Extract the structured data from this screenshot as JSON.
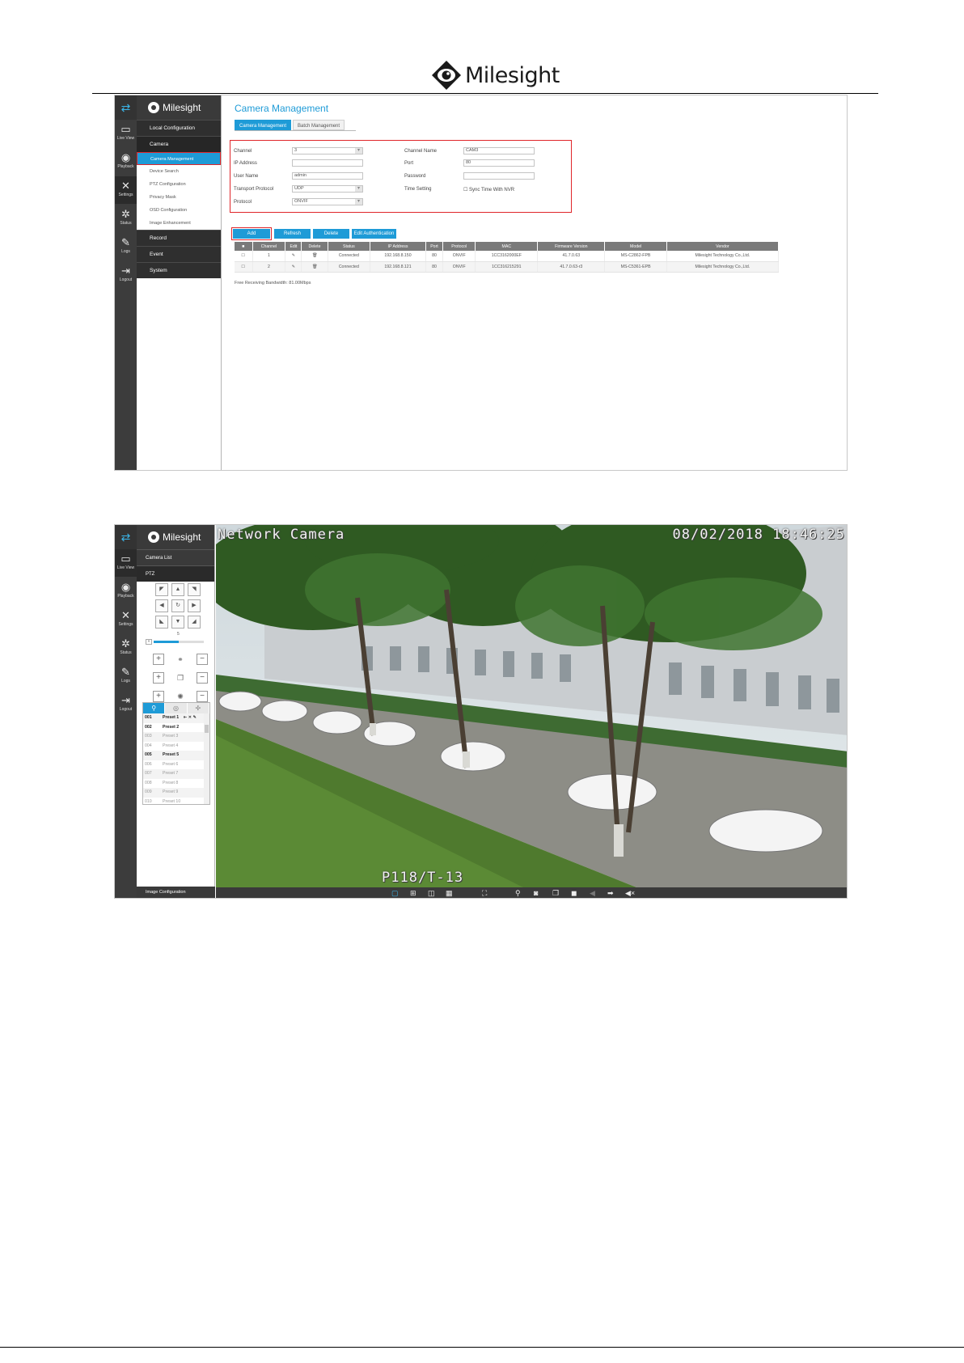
{
  "brand": {
    "name": "Milesight"
  },
  "iconbar": {
    "live_view": "Live View",
    "playback": "Playback",
    "settings": "Settings",
    "status": "Status",
    "logs": "Logs",
    "logout": "Logout"
  },
  "screen1": {
    "menu": {
      "local_config": "Local Configuration",
      "camera": "Camera",
      "sub_items": [
        "Camera Management",
        "Device Search",
        "PTZ Configuration",
        "Privacy Mask",
        "OSD Configuration",
        "Image Enhancement"
      ],
      "record": "Record",
      "event": "Event",
      "system": "System"
    },
    "title": "Camera Management",
    "tabs": [
      "Camera Management",
      "Batch Management"
    ],
    "form": {
      "channel_label": "Channel",
      "channel_value": "3",
      "ip_label": "IP Address",
      "ip_value": "",
      "user_label": "User Name",
      "user_value": "admin",
      "transport_label": "Transport Protocol",
      "transport_value": "UDP",
      "protocol_label": "Protocol",
      "protocol_value": "ONVIF",
      "chname_label": "Channel Name",
      "chname_value": "CAM3",
      "port_label": "Port",
      "port_value": "80",
      "password_label": "Password",
      "password_value": "",
      "timeset_label": "Time Setting",
      "timeset_value": "Sync Time With NVR"
    },
    "buttons": {
      "add": "Add",
      "refresh": "Refresh",
      "delete": "Delete",
      "edit_auth": "Edit Authentication"
    },
    "table": {
      "headers": [
        "Channel",
        "Edit",
        "Delete",
        "Status",
        "IP Address",
        "Port",
        "Protocol",
        "MAC",
        "Firmware Version",
        "Model",
        "Vendor"
      ],
      "rows": [
        [
          "1",
          "Connected",
          "192.168.8.150",
          "80",
          "ONVIF",
          "1CC3162000EF",
          "41.7.0.63",
          "MS-C2862-FPB",
          "Milesight Technology Co.,Ltd."
        ],
        [
          "2",
          "Connected",
          "192.168.8.121",
          "80",
          "ONVIF",
          "1CC316215291",
          "41.7.0.63-r3",
          "MS-C5361-EPB",
          "Milesight Technology Co.,Ltd."
        ]
      ]
    },
    "bandwidth": "Free Receiving Bandwidth:  81.00Mbps"
  },
  "screen2": {
    "menu": {
      "camera_list": "Camera List",
      "ptz": "PTZ",
      "image_config": "Image Configuration"
    },
    "speed_value": "5",
    "presets": [
      {
        "num": "001",
        "name": "Preset 1",
        "bold": true
      },
      {
        "num": "002",
        "name": "Preset 2",
        "bold": true
      },
      {
        "num": "003",
        "name": "Preset 3",
        "bold": false
      },
      {
        "num": "004",
        "name": "Preset 4",
        "bold": false
      },
      {
        "num": "005",
        "name": "Preset 5",
        "bold": true
      },
      {
        "num": "006",
        "name": "Preset 6",
        "bold": false
      },
      {
        "num": "007",
        "name": "Preset 7",
        "bold": false
      },
      {
        "num": "008",
        "name": "Preset 8",
        "bold": false
      },
      {
        "num": "009",
        "name": "Preset 9",
        "bold": false
      },
      {
        "num": "010",
        "name": "Preset 10",
        "bold": false
      }
    ],
    "osd": {
      "camera_name": "Network Camera",
      "datetime": "08/02/2018  18:46:25",
      "ptz_position": "P118/T-13"
    }
  },
  "colors": {
    "accent": "#1e9bd7",
    "highlight": "#e0262a",
    "sidebar": "#3c3c3c"
  }
}
